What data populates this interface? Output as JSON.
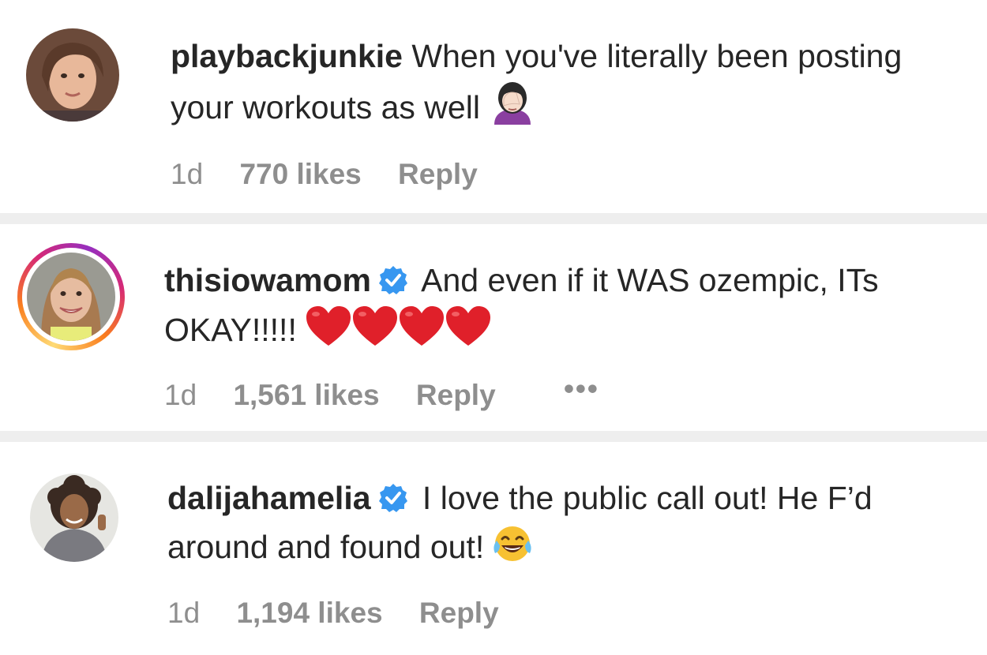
{
  "comments": [
    {
      "username": "playbackjunkie",
      "verified": false,
      "text": "When you've literally been posting your workouts as well",
      "emoji": "woman-facepalming-icon",
      "time": "1d",
      "likes": "770 likes",
      "reply": "Reply"
    },
    {
      "username": "thisiowamom",
      "verified": true,
      "text": "And even if it WAS ozempic, ITs OKAY!!!!!",
      "emoji": "red-heart-icon x4",
      "time": "1d",
      "likes": "1,561 likes",
      "reply": "Reply",
      "more": "•••"
    },
    {
      "username": "dalijahamelia",
      "verified": true,
      "text": "I love the public call out! He F’d around and found out!",
      "emoji": "face-with-tears-of-joy-icon",
      "time": "1d",
      "likes": "1,194 likes",
      "reply": "Reply"
    }
  ],
  "colors": {
    "text": "#262626",
    "meta": "#8e8e8e",
    "divider": "#eeeeee",
    "verified_badge": "#3797f0",
    "heart": "#e0202a"
  }
}
